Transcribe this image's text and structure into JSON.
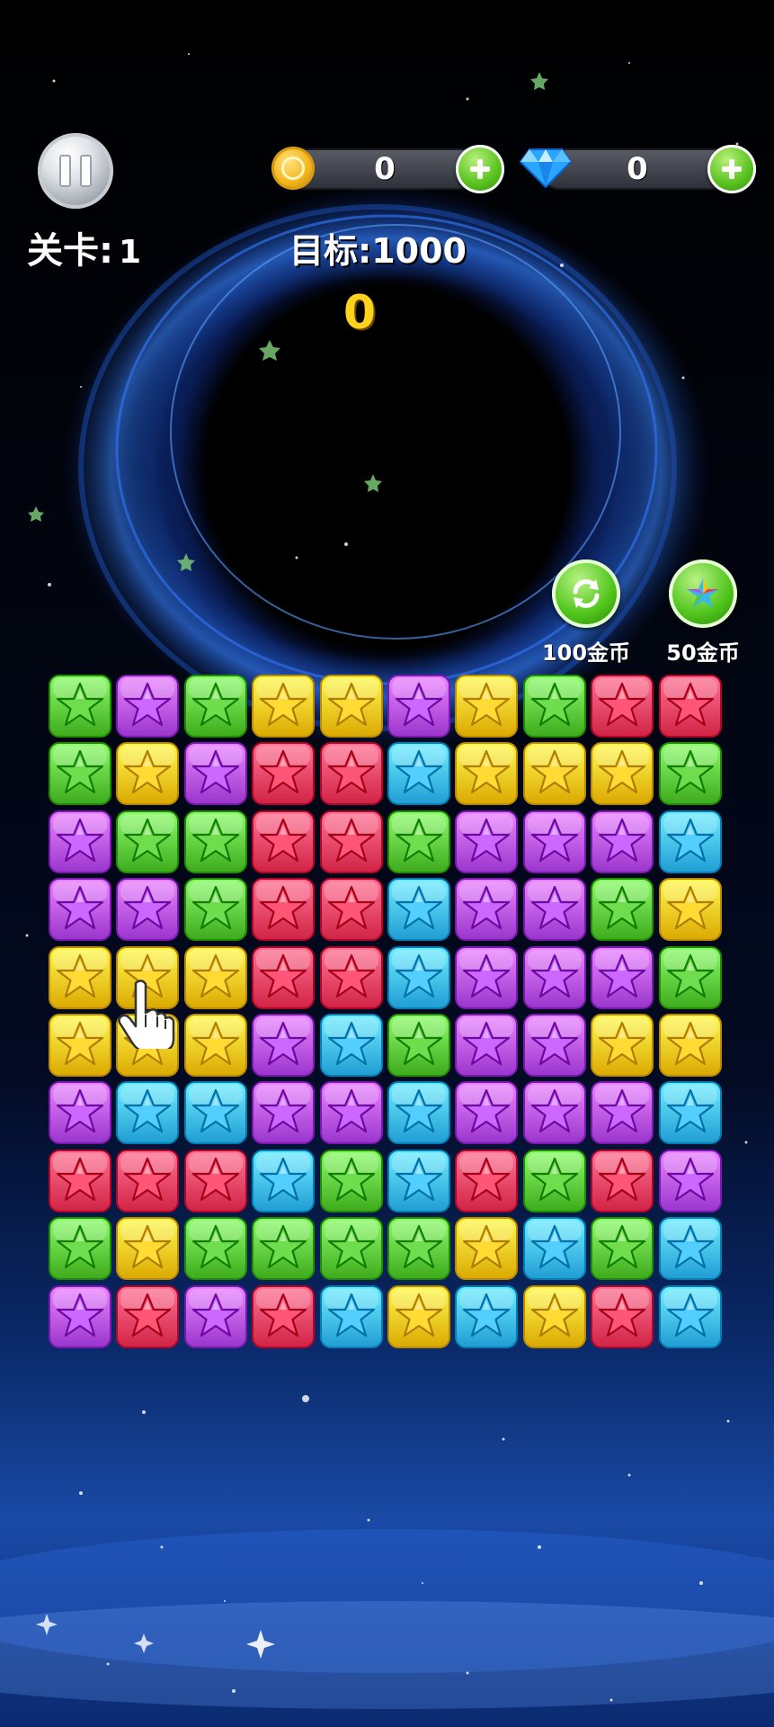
{
  "hud": {
    "level_label": "关卡:",
    "level_value": "1",
    "coins": "0",
    "diamonds": "0",
    "target_label": "目标:1000",
    "score": "0"
  },
  "tools": [
    {
      "icon": "refresh-icon",
      "cost": "100金币"
    },
    {
      "icon": "rainbow-star-icon",
      "cost": "50金币"
    }
  ],
  "colors": {
    "green": "#56c434",
    "purple": "#b34ee6",
    "yellow": "#f4c21a",
    "red": "#ea3c5e",
    "blue": "#39b6ec"
  },
  "board": {
    "rows": [
      [
        "green",
        "purple",
        "green",
        "yellow",
        "yellow",
        "purple",
        "yellow",
        "green",
        "red",
        "red"
      ],
      [
        "green",
        "yellow",
        "purple",
        "red",
        "red",
        "blue",
        "yellow",
        "yellow",
        "yellow",
        "green"
      ],
      [
        "purple",
        "green",
        "green",
        "red",
        "red",
        "green",
        "purple",
        "purple",
        "purple",
        "blue"
      ],
      [
        "purple",
        "purple",
        "green",
        "red",
        "red",
        "blue",
        "purple",
        "purple",
        "green",
        "yellow"
      ],
      [
        "yellow",
        "yellow",
        "yellow",
        "red",
        "red",
        "blue",
        "purple",
        "purple",
        "purple",
        "green"
      ],
      [
        "yellow",
        "yellow",
        "yellow",
        "purple",
        "blue",
        "green",
        "purple",
        "purple",
        "yellow",
        "yellow"
      ],
      [
        "purple",
        "blue",
        "blue",
        "purple",
        "purple",
        "blue",
        "purple",
        "purple",
        "purple",
        "blue"
      ],
      [
        "red",
        "red",
        "red",
        "blue",
        "green",
        "blue",
        "red",
        "green",
        "red",
        "purple"
      ],
      [
        "green",
        "yellow",
        "green",
        "green",
        "green",
        "green",
        "yellow",
        "blue",
        "green",
        "blue"
      ],
      [
        "purple",
        "red",
        "purple",
        "red",
        "blue",
        "yellow",
        "blue",
        "yellow",
        "red",
        "blue"
      ]
    ]
  }
}
